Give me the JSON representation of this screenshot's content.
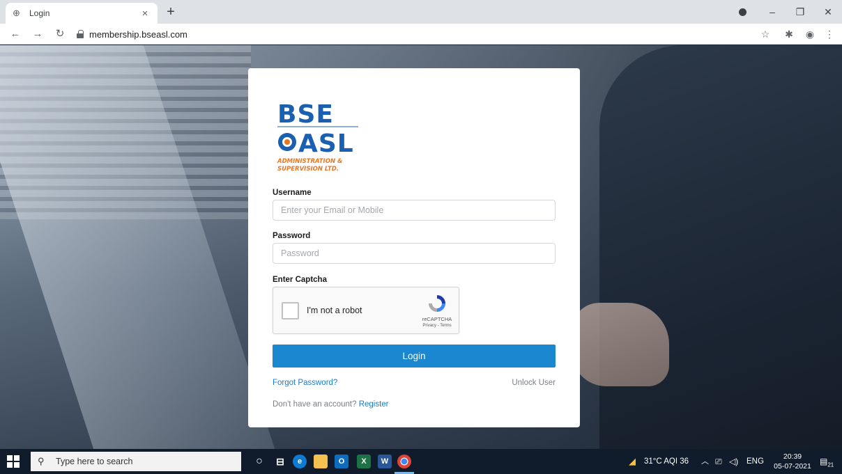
{
  "browser": {
    "tab_title": "Login",
    "tab_close": "×",
    "new_tab": "+",
    "url": "membership.bseasl.com",
    "window_controls": [
      "–",
      "❐",
      "✕"
    ]
  },
  "logo": {
    "line1": "BSE",
    "line2": "ASL",
    "tag1": "ADMINISTRATION &",
    "tag2": "SUPERVISION LTD.",
    "colors": {
      "blue": "#1b5fb0",
      "orange": "#e87722"
    }
  },
  "form": {
    "username_label": "Username",
    "username_placeholder": "Enter your Email or Mobile",
    "password_label": "Password",
    "password_placeholder": "Password",
    "captcha_label": "Enter Captcha",
    "captcha_text": "I'm not a robot",
    "captcha_brand": "reCAPTCHA",
    "captcha_links": "Privacy - Terms",
    "login_button": "Login",
    "forgot_link": "Forgot Password?",
    "unlock_link": "Unlock User",
    "account_text": "Don't have an account?",
    "register_link": "Register",
    "accent_color": "#1a87d0"
  },
  "taskbar": {
    "search_placeholder": "Type here to search",
    "weather": "31°C  AQI 36",
    "language": "ENG",
    "time": "20:39",
    "date": "05-07-2021",
    "notifications": "21"
  }
}
